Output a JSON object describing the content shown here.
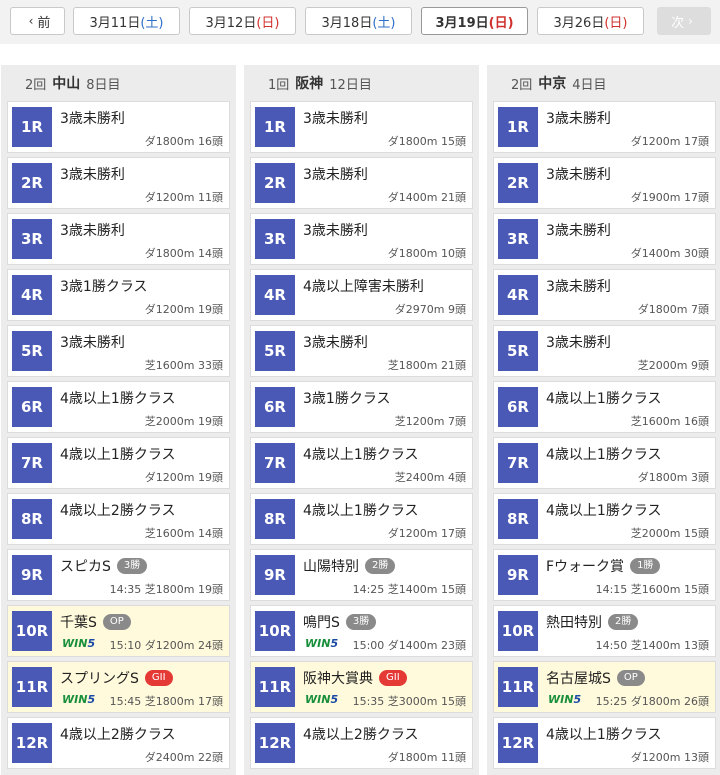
{
  "nav": {
    "prev_label": "前",
    "next_label": "次",
    "dates": [
      {
        "label": "3月11日",
        "dow": "(土)",
        "kind": "sat",
        "active": false
      },
      {
        "label": "3月12日",
        "dow": "(日)",
        "kind": "sun",
        "active": false
      },
      {
        "label": "3月18日",
        "dow": "(土)",
        "kind": "sat",
        "active": false
      },
      {
        "label": "3月19日",
        "dow": "(日)",
        "kind": "sun",
        "active": true
      },
      {
        "label": "3月26日",
        "dow": "(日)",
        "kind": "sun",
        "active": false
      }
    ]
  },
  "venues": [
    {
      "kai": "2回",
      "name": "中山",
      "day": "8日目",
      "races": [
        {
          "num": "1R",
          "name": "3歳未勝利",
          "info": "ダ1800m 16頭"
        },
        {
          "num": "2R",
          "name": "3歳未勝利",
          "info": "ダ1200m 11頭"
        },
        {
          "num": "3R",
          "name": "3歳未勝利",
          "info": "ダ1800m 14頭"
        },
        {
          "num": "4R",
          "name": "3歳1勝クラス",
          "info": "ダ1200m 19頭"
        },
        {
          "num": "5R",
          "name": "3歳未勝利",
          "info": "芝1600m 33頭"
        },
        {
          "num": "6R",
          "name": "4歳以上1勝クラス",
          "info": "芝2000m 19頭"
        },
        {
          "num": "7R",
          "name": "4歳以上1勝クラス",
          "info": "ダ1200m 19頭"
        },
        {
          "num": "8R",
          "name": "4歳以上2勝クラス",
          "info": "芝1600m 14頭"
        },
        {
          "num": "9R",
          "name": "スピカS",
          "badge": "3勝",
          "badge_kind": "win",
          "info": "14:35 芝1800m 19頭"
        },
        {
          "num": "10R",
          "name": "千葉S",
          "badge": "OP",
          "badge_kind": "op",
          "win5": true,
          "highlight": true,
          "info": "15:10 ダ1200m 24頭"
        },
        {
          "num": "11R",
          "name": "スプリングS",
          "badge": "GII",
          "badge_kind": "g2",
          "win5": true,
          "highlight": true,
          "info": "15:45 芝1800m 17頭"
        },
        {
          "num": "12R",
          "name": "4歳以上2勝クラス",
          "info": "ダ2400m 22頭"
        }
      ]
    },
    {
      "kai": "1回",
      "name": "阪神",
      "day": "12日目",
      "races": [
        {
          "num": "1R",
          "name": "3歳未勝利",
          "info": "ダ1800m 15頭"
        },
        {
          "num": "2R",
          "name": "3歳未勝利",
          "info": "ダ1400m 21頭"
        },
        {
          "num": "3R",
          "name": "3歳未勝利",
          "info": "ダ1800m 10頭"
        },
        {
          "num": "4R",
          "name": "4歳以上障害未勝利",
          "info": "ダ2970m 9頭"
        },
        {
          "num": "5R",
          "name": "3歳未勝利",
          "info": "芝1800m 21頭"
        },
        {
          "num": "6R",
          "name": "3歳1勝クラス",
          "info": "芝1200m 7頭"
        },
        {
          "num": "7R",
          "name": "4歳以上1勝クラス",
          "info": "芝2400m 4頭"
        },
        {
          "num": "8R",
          "name": "4歳以上1勝クラス",
          "info": "ダ1200m 17頭"
        },
        {
          "num": "9R",
          "name": "山陽特別",
          "badge": "2勝",
          "badge_kind": "win",
          "info": "14:25 芝1400m 15頭"
        },
        {
          "num": "10R",
          "name": "鳴門S",
          "badge": "3勝",
          "badge_kind": "win",
          "win5": true,
          "info": "15:00 ダ1400m 23頭"
        },
        {
          "num": "11R",
          "name": "阪神大賞典",
          "badge": "GII",
          "badge_kind": "g2",
          "win5": true,
          "highlight": true,
          "info": "15:35 芝3000m 15頭"
        },
        {
          "num": "12R",
          "name": "4歳以上2勝クラス",
          "info": "ダ1800m 11頭"
        }
      ]
    },
    {
      "kai": "2回",
      "name": "中京",
      "day": "4日目",
      "races": [
        {
          "num": "1R",
          "name": "3歳未勝利",
          "info": "ダ1200m 17頭"
        },
        {
          "num": "2R",
          "name": "3歳未勝利",
          "info": "ダ1900m 17頭"
        },
        {
          "num": "3R",
          "name": "3歳未勝利",
          "info": "ダ1400m 30頭"
        },
        {
          "num": "4R",
          "name": "3歳未勝利",
          "info": "ダ1800m 7頭"
        },
        {
          "num": "5R",
          "name": "3歳未勝利",
          "info": "芝2000m 9頭"
        },
        {
          "num": "6R",
          "name": "4歳以上1勝クラス",
          "info": "芝1600m 16頭"
        },
        {
          "num": "7R",
          "name": "4歳以上1勝クラス",
          "info": "ダ1800m 3頭"
        },
        {
          "num": "8R",
          "name": "4歳以上1勝クラス",
          "info": "芝2000m 15頭"
        },
        {
          "num": "9R",
          "name": "Fウォーク賞",
          "badge": "1勝",
          "badge_kind": "win",
          "info": "14:15 芝1600m 15頭"
        },
        {
          "num": "10R",
          "name": "熱田特別",
          "badge": "2勝",
          "badge_kind": "win",
          "info": "14:50 芝1400m 13頭"
        },
        {
          "num": "11R",
          "name": "名古屋城S",
          "badge": "OP",
          "badge_kind": "op",
          "win5": true,
          "highlight": true,
          "info": "15:25 ダ1800m 26頭"
        },
        {
          "num": "12R",
          "name": "4歳以上1勝クラス",
          "info": "ダ1200m 13頭"
        }
      ]
    }
  ]
}
